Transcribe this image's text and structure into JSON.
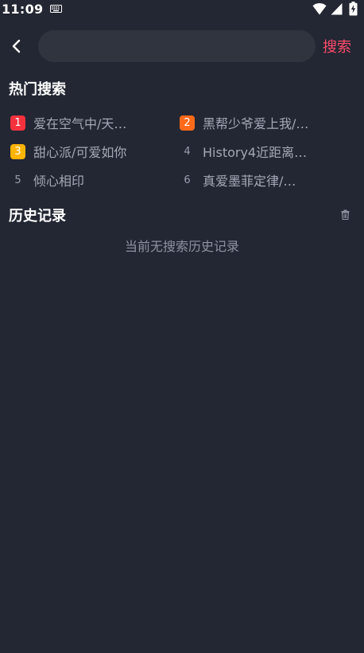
{
  "status_bar": {
    "time": "11:09",
    "icons": [
      "keyboard-icon",
      "wifi-icon",
      "signal-icon",
      "battery-charging-icon"
    ]
  },
  "header": {
    "back_icon": "chevron-left-icon",
    "search_placeholder": "",
    "search_value": "",
    "search_label": "搜索"
  },
  "hot_search": {
    "title": "热门搜索",
    "items": [
      {
        "rank": "1",
        "text": "爱在空气中/天…",
        "badge_color": "#f5313e"
      },
      {
        "rank": "2",
        "text": "黑帮少爷爱上我/…",
        "badge_color": "#ff6a1a"
      },
      {
        "rank": "3",
        "text": "甜心派/可爱如你",
        "badge_color": "#ffb400"
      },
      {
        "rank": "4",
        "text": "History4近距离…",
        "badge_color": ""
      },
      {
        "rank": "5",
        "text": "倾心相印",
        "badge_color": ""
      },
      {
        "rank": "6",
        "text": "真爱墨菲定律/…",
        "badge_color": ""
      }
    ]
  },
  "history": {
    "title": "历史记录",
    "clear_icon": "trash-icon",
    "empty_text": "当前无搜索历史记录"
  },
  "colors": {
    "background": "#232733",
    "input_background": "#30343f",
    "accent": "#ff4a6b",
    "item_text": "#a4a8b6",
    "empty_text": "#8e92a1"
  }
}
